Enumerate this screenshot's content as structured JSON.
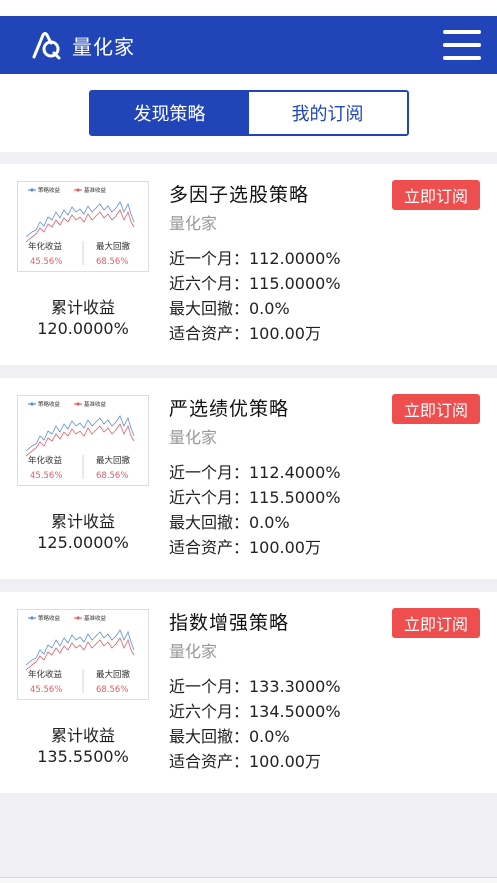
{
  "app": {
    "title": "量化家"
  },
  "tabs": [
    {
      "label": "发现策略",
      "active": true
    },
    {
      "label": "我的订阅",
      "active": false
    }
  ],
  "thumbnail": {
    "legend_strategy": "策略收益",
    "legend_benchmark": "基准收益",
    "annual_label": "年化收益",
    "annual_value": "45.56%",
    "drawdown_label": "最大回撤",
    "drawdown_value": "68.56%"
  },
  "strategies": [
    {
      "name": "多因子选股策略",
      "author": "量化家",
      "subscribe_label": "立即订阅",
      "cumulative_label": "累计收益",
      "cumulative_value": "120.0000%",
      "stats": [
        "近一个月：112.0000%",
        "近六个月：115.0000%",
        "最大回撤：0.0%",
        "适合资产：100.00万"
      ]
    },
    {
      "name": "严选绩优策略",
      "author": "量化家",
      "subscribe_label": "立即订阅",
      "cumulative_label": "累计收益",
      "cumulative_value": "125.0000%",
      "stats": [
        "近一个月：112.4000%",
        "近六个月：115.5000%",
        "最大回撤：0.0%",
        "适合资产：100.00万"
      ]
    },
    {
      "name": "指数增强策略",
      "author": "量化家",
      "subscribe_label": "立即订阅",
      "cumulative_label": "累计收益",
      "cumulative_value": "135.5500%",
      "stats": [
        "近一个月：133.3000%",
        "近六个月：134.5000%",
        "最大回撤：0.0%",
        "适合资产：100.00万"
      ]
    }
  ],
  "colors": {
    "brand": "#2145b8",
    "subscribe": "#ee4e4e",
    "strategy_line": "#5b8fd6",
    "benchmark_line": "#e0606a"
  }
}
